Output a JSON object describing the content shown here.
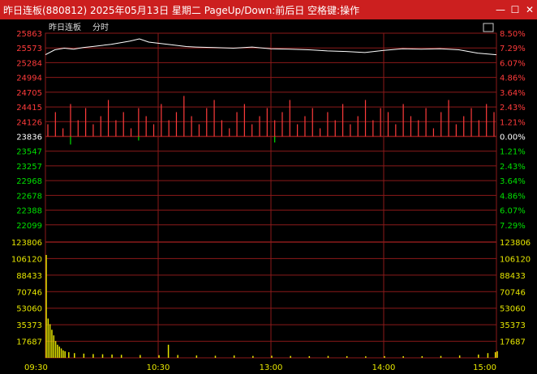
{
  "window": {
    "title": "昨日连板(880812) 2025年05月13日 星期二 PageUp/Down:前后日 空格键:操作",
    "minimize_glyph": "—",
    "maximize_glyph": "☐",
    "close_glyph": "✕"
  },
  "header": {
    "stock_name": "昨日连板",
    "mode_label": "分时"
  },
  "colors": {
    "up": "#ff3b3b",
    "down": "#00e000",
    "neutral": "#ffffff",
    "volume_axis": "#e6e600",
    "grid": "#8b1a1a",
    "price_line": "#ffffff",
    "volume_bar": "#e6e600"
  },
  "chart_data": {
    "type": "line",
    "time_labels": [
      "09:30",
      "10:30",
      "13:00",
      "14:00",
      "15:00"
    ],
    "price_axis": {
      "up_ticks": [
        "25863",
        "25573",
        "25284",
        "24994",
        "24705",
        "24415",
        "24126"
      ],
      "base": "23836",
      "down_ticks": [
        "23547",
        "23257",
        "22968",
        "22678",
        "22388",
        "22099"
      ],
      "ylim": [
        22099,
        25863
      ]
    },
    "percent_axis": {
      "up_ticks": [
        "8.50%",
        "7.29%",
        "6.07%",
        "4.86%",
        "3.64%",
        "2.43%",
        "1.21%"
      ],
      "base": "0.00%",
      "down_ticks": [
        "1.21%",
        "2.43%",
        "3.64%",
        "4.86%",
        "6.07%",
        "7.29%"
      ]
    },
    "volume_axis": {
      "ticks": [
        "123806",
        "106120",
        "88433",
        "70746",
        "53060",
        "35373",
        "17687"
      ],
      "max": 123806
    },
    "price_series": {
      "name": "",
      "points": [
        [
          0,
          25470
        ],
        [
          5,
          25560
        ],
        [
          10,
          25590
        ],
        [
          15,
          25570
        ],
        [
          20,
          25600
        ],
        [
          25,
          25620
        ],
        [
          30,
          25640
        ],
        [
          35,
          25660
        ],
        [
          40,
          25690
        ],
        [
          45,
          25720
        ],
        [
          50,
          25760
        ],
        [
          55,
          25700
        ],
        [
          60,
          25680
        ],
        [
          65,
          25660
        ],
        [
          70,
          25640
        ],
        [
          75,
          25620
        ],
        [
          80,
          25610
        ],
        [
          90,
          25600
        ],
        [
          100,
          25590
        ],
        [
          110,
          25610
        ],
        [
          120,
          25580
        ],
        [
          130,
          25570
        ],
        [
          140,
          25560
        ],
        [
          150,
          25540
        ],
        [
          160,
          25530
        ],
        [
          170,
          25510
        ],
        [
          180,
          25550
        ],
        [
          190,
          25580
        ],
        [
          200,
          25570
        ],
        [
          210,
          25580
        ],
        [
          220,
          25560
        ],
        [
          230,
          25500
        ],
        [
          240,
          25470
        ]
      ]
    },
    "volume_series": {
      "bars": [
        [
          0,
          110000
        ],
        [
          1,
          42000
        ],
        [
          2,
          36000
        ],
        [
          3,
          30000
        ],
        [
          4,
          24000
        ],
        [
          5,
          18000
        ],
        [
          6,
          14000
        ],
        [
          7,
          12000
        ],
        [
          8,
          10000
        ],
        [
          9,
          8000
        ],
        [
          10,
          7000
        ],
        [
          12,
          6000
        ],
        [
          15,
          5000
        ],
        [
          20,
          4500
        ],
        [
          25,
          4000
        ],
        [
          30,
          3800
        ],
        [
          35,
          3500
        ],
        [
          40,
          3200
        ],
        [
          50,
          3000
        ],
        [
          60,
          2800
        ],
        [
          65,
          14000
        ],
        [
          70,
          3000
        ],
        [
          80,
          2500
        ],
        [
          90,
          2200
        ],
        [
          100,
          2500
        ],
        [
          110,
          2000
        ],
        [
          120,
          2200
        ],
        [
          130,
          2000
        ],
        [
          140,
          1800
        ],
        [
          150,
          2000
        ],
        [
          160,
          1800
        ],
        [
          170,
          1600
        ],
        [
          180,
          1800
        ],
        [
          190,
          1700
        ],
        [
          200,
          1800
        ],
        [
          210,
          2000
        ],
        [
          220,
          2500
        ],
        [
          230,
          3500
        ],
        [
          235,
          5000
        ],
        [
          239,
          6000
        ],
        [
          240,
          7000
        ]
      ]
    },
    "tick_bars": {
      "up_values": [
        30,
        60,
        20,
        80,
        40,
        70,
        30,
        50,
        90,
        40,
        60,
        20,
        70,
        50,
        30,
        80,
        40,
        60,
        100,
        50,
        30,
        70,
        90,
        40,
        20,
        60,
        80,
        30,
        50,
        70,
        40,
        60,
        90,
        30,
        50,
        70,
        20,
        60,
        40,
        80,
        30,
        50,
        90,
        40,
        70,
        60,
        30,
        80,
        50,
        40,
        70,
        20,
        60,
        90,
        30,
        50,
        70,
        40,
        80,
        60
      ],
      "down_values": [
        0,
        0,
        0,
        20,
        0,
        0,
        0,
        0,
        0,
        0,
        0,
        0,
        10,
        0,
        0,
        0,
        0,
        0,
        0,
        0,
        0,
        0,
        0,
        0,
        0,
        0,
        0,
        0,
        0,
        0,
        15,
        0,
        0,
        0,
        0,
        0,
        0,
        0,
        0,
        0,
        0,
        0,
        0,
        0,
        0,
        0,
        0,
        0,
        0,
        0,
        0,
        0,
        0,
        0,
        0,
        0,
        0,
        0,
        0,
        0
      ]
    }
  }
}
